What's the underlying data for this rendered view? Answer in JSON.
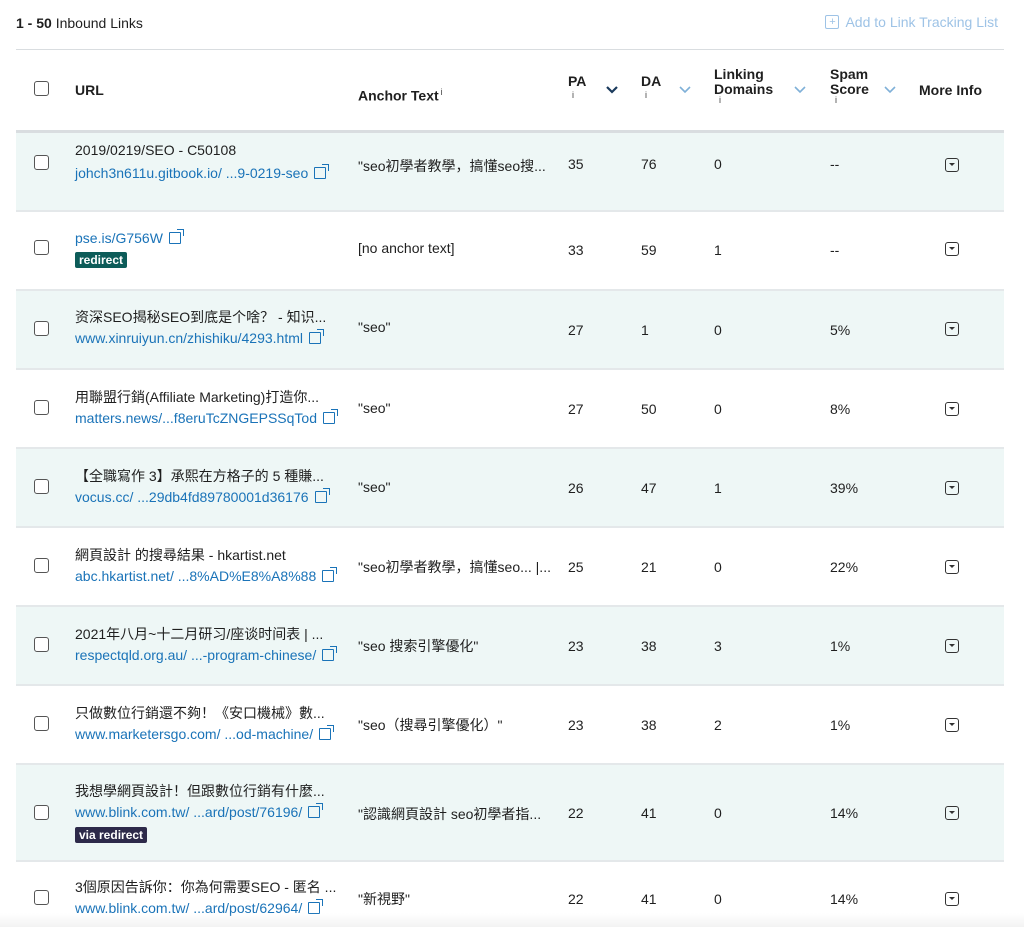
{
  "header": {
    "range": "1 - 50",
    "label": "Inbound Links",
    "add_link": "Add to Link Tracking List"
  },
  "columns": {
    "url": "URL",
    "anchor": "Anchor Text",
    "pa": "PA",
    "da": "DA",
    "linking_line1": "Linking",
    "linking_line2": "Domains",
    "spam_line1": "Spam",
    "spam_line2": "Score",
    "more": "More Info",
    "info": "i"
  },
  "rows": [
    {
      "title": "2019/0219/SEO - C50108",
      "url": "johch3n611u.gitbook.io/  ...9-0219-seo",
      "anchor": "\"seo初學者教學，搞懂seo搜...",
      "pa": "35",
      "da": "76",
      "ld": "0",
      "spam": "--"
    },
    {
      "title": "",
      "url": "pse.is/G756W",
      "badge": "redirect",
      "anchor": "[no anchor text]",
      "pa": "33",
      "da": "59",
      "ld": "1",
      "spam": "--"
    },
    {
      "title": "资深SEO揭秘SEO到底是个啥？ - 知识...",
      "url": "www.xinruiyun.cn/zhishiku/4293.html",
      "anchor": "\"seo\"",
      "pa": "27",
      "da": "1",
      "ld": "0",
      "spam": "5%"
    },
    {
      "title": "用聯盟行銷(Affiliate Marketing)打造你...",
      "url": "matters.news/...f8eruTcZNGEPSSqTod",
      "anchor": "\"seo\"",
      "pa": "27",
      "da": "50",
      "ld": "0",
      "spam": "8%"
    },
    {
      "title": "【全職寫作 3】承熙在方格子的 5 種賺...",
      "url": "vocus.cc/  ...29db4fd89780001d36176",
      "anchor": "\"seo\"",
      "pa": "26",
      "da": "47",
      "ld": "1",
      "spam": "39%"
    },
    {
      "title": "網頁設計 的搜尋結果 - hkartist.net",
      "url": "abc.hkartist.net/  ...8%AD%E8%A8%88",
      "anchor": "\"seo初學者教學，搞懂seo... |...",
      "pa": "25",
      "da": "21",
      "ld": "0",
      "spam": "22%"
    },
    {
      "title": "2021年八月~十二月研习/座谈时间表 | ...",
      "url": "respectqld.org.au/  ...-program-chinese/",
      "anchor": "\"seo 搜索引擎優化\"",
      "pa": "23",
      "da": "38",
      "ld": "3",
      "spam": "1%"
    },
    {
      "title": "只做數位行銷還不夠！《安口機械》數...",
      "url": "www.marketersgo.com/  ...od-machine/",
      "anchor": "\"seo（搜尋引擎優化）\"",
      "pa": "23",
      "da": "38",
      "ld": "2",
      "spam": "1%"
    },
    {
      "title": "我想學網頁設計！但跟數位行銷有什麼...",
      "url": "www.blink.com.tw/  ...ard/post/76196/",
      "badge": "via redirect",
      "anchor": "\"認識網頁設計 seo初學者指...",
      "pa": "22",
      "da": "41",
      "ld": "0",
      "spam": "14%"
    },
    {
      "title": "3個原因告訴你：你為何需要SEO - 匿名 ...",
      "url": "www.blink.com.tw/  ...ard/post/62964/",
      "anchor": "\"新視野\"",
      "pa": "22",
      "da": "41",
      "ld": "0",
      "spam": "14%"
    }
  ]
}
